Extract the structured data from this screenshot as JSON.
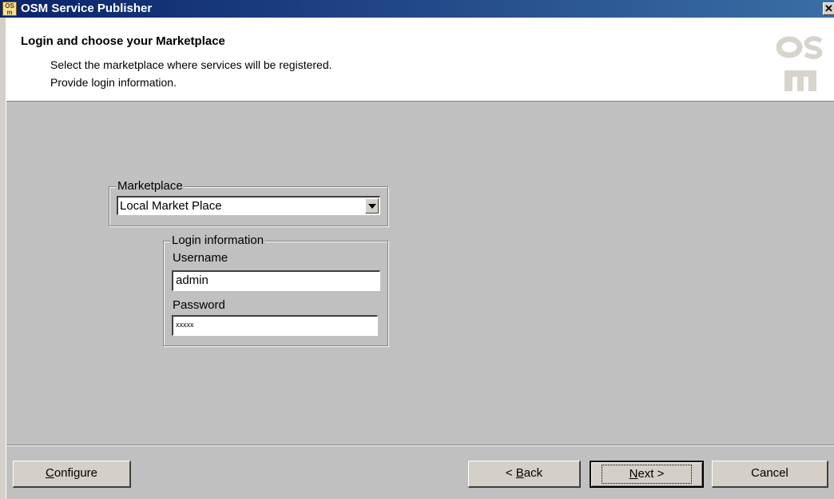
{
  "window": {
    "title": "OSM Service Publisher",
    "close_glyph": "✕"
  },
  "header": {
    "title": "Login and choose your Marketplace",
    "line1": "Select the marketplace where services will be registered.",
    "line2": "Provide login information.",
    "logo_icon": "osm-logo-icon"
  },
  "marketplace": {
    "legend": "Marketplace",
    "selected": "Local Market Place"
  },
  "login": {
    "legend": "Login information",
    "username_label": "Username",
    "username_value": "admin",
    "password_label": "Password",
    "password_value": "xxxxx"
  },
  "buttons": {
    "configure": {
      "accel": "C",
      "rest": "onfigure"
    },
    "back": {
      "prefix": "< ",
      "accel": "B",
      "rest": "ack"
    },
    "next": {
      "accel": "N",
      "rest": "ext >"
    },
    "cancel": "Cancel"
  },
  "colors": {
    "titlebar_start": "#0a246a",
    "titlebar_end": "#3a6ea5",
    "dialog_bg": "#c0c0c0",
    "header_bg": "#ffffff",
    "logo_color": "#d8d4cc"
  }
}
